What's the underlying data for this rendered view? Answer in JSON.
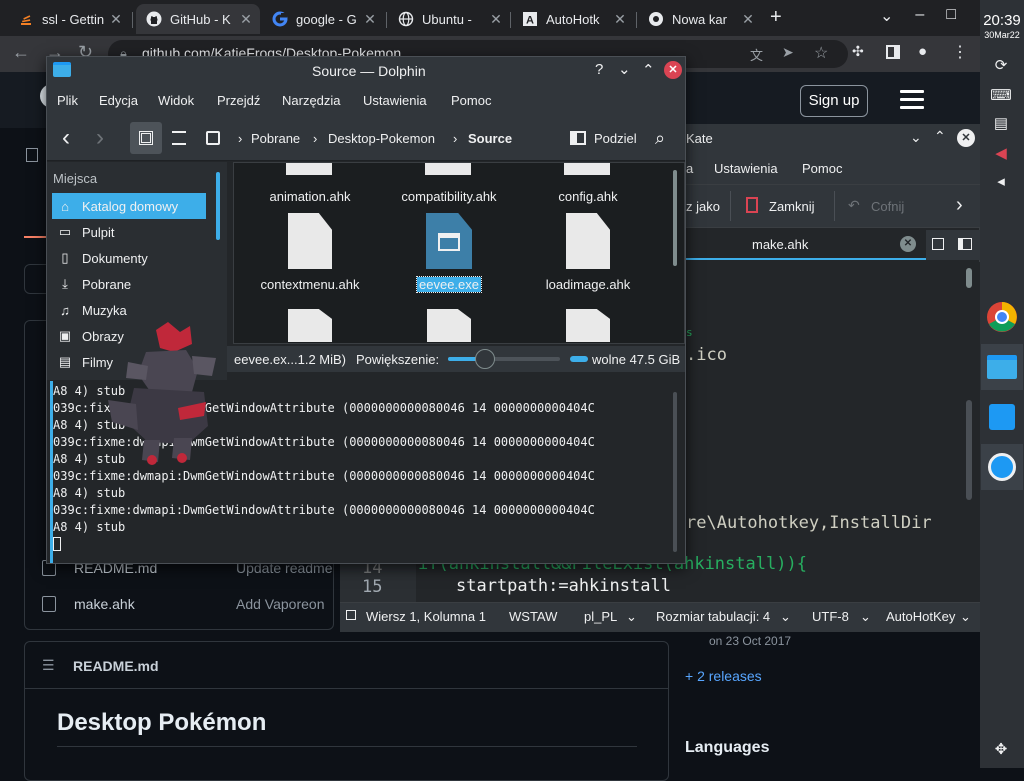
{
  "browser": {
    "tabs": [
      {
        "title": "ssl - Gettin",
        "icon": "stackoverflow-icon"
      },
      {
        "title": "GitHub - K",
        "icon": "github-icon"
      },
      {
        "title": "google - G",
        "icon": "google-icon"
      },
      {
        "title": "Ubuntu - ",
        "icon": "globe-icon"
      },
      {
        "title": "AutoHotk",
        "icon": "autohotkey-icon"
      },
      {
        "title": "Nowa kar",
        "icon": "chrome-icon"
      }
    ],
    "url": "github.com/KatieFrogs/Desktop-Pokemon"
  },
  "github": {
    "signup": "Sign up",
    "files": [
      {
        "name": "README.md",
        "message": "Update readme"
      },
      {
        "name": "make.ahk",
        "message": "Add Vaporeon"
      }
    ],
    "readme_title": "README.md",
    "heading": "Desktop Pokémon",
    "release_date": "on 23 Oct 2017",
    "releases": "+ 2 releases",
    "languages": "Languages"
  },
  "kate": {
    "title": "Kate",
    "menu": [
      "a",
      "Ustawienia",
      "Pomoc"
    ],
    "toolbar": {
      "save_as": "z jako",
      "close": "Zamknij",
      "undo": "Cofnij"
    },
    "tab": "make.ahk",
    "code": {
      "fragment1": "s",
      "fragment2": ".ico",
      "fragment3": "re\\Autohotkey,InstallDir",
      "line14_num": "14",
      "line14": "if(ahkinstall&&FileExist(ahkinstall)){",
      "line15_num": "15",
      "line15": "startpath:=ahkinstall"
    },
    "status": {
      "position": "Wiersz 1, Kolumna 1",
      "mode": "WSTAW",
      "lang": "pl_PL",
      "tab_size": "Rozmiar tabulacji: 4",
      "encoding": "UTF-8",
      "syntax": "AutoHotKey"
    }
  },
  "dolphin": {
    "title": "Source — Dolphin",
    "menu": [
      "Plik",
      "Edycja",
      "Widok",
      "Przejdź",
      "Narzędzia",
      "Ustawienia",
      "Pomoc"
    ],
    "breadcrumb": [
      "Pobrane",
      "Desktop-Pokemon",
      "Source"
    ],
    "split_label": "Podziel",
    "places_header": "Miejsca",
    "places": [
      {
        "label": "Katalog domowy",
        "icon": "home-icon"
      },
      {
        "label": "Pulpit",
        "icon": "desktop-icon"
      },
      {
        "label": "Dokumenty",
        "icon": "documents-icon"
      },
      {
        "label": "Pobrane",
        "icon": "download-icon"
      },
      {
        "label": "Muzyka",
        "icon": "music-icon"
      },
      {
        "label": "Obrazy",
        "icon": "pictures-icon"
      },
      {
        "label": "Filmy",
        "icon": "videos-icon"
      }
    ],
    "files": [
      "animation.ahk",
      "compatibility.ahk",
      "config.ahk",
      "contextmenu.ahk",
      "eevee.exe",
      "loadimage.ahk"
    ],
    "selected_file": "eevee.exe",
    "status_file": "eevee.ex...1.2 MiB)",
    "zoom_label": "Powiększenie:",
    "zoom_fraction": 0.33,
    "free_space": "wolne 47.5 GiB",
    "terminal": [
      "A8 4) stub",
      "039c:fixme:dwmapi:DwmGetWindowAttribute (0000000000080046 14 0000000000404C",
      "A8 4) stub",
      "039c:fixme:dwmapi:DwmGetWindowAttribute (0000000000080046 14 0000000000404C",
      "A8 4) stub",
      "039c:fixme:dwmapi:DwmGetWindowAttribute (0000000000080046 14 0000000000404C",
      "A8 4) stub",
      "039c:fixme:dwmapi:DwmGetWindowAttribute (0000000000080046 14 0000000000404C",
      "A8 4) stub"
    ]
  },
  "panel": {
    "time": "20:39",
    "date": "30Mar22"
  },
  "colors": {
    "accent": "#3daee9",
    "window_bg": "#232629",
    "window_chrome": "#31363b",
    "github_bg": "#0d1117",
    "close_red": "#da4453"
  }
}
